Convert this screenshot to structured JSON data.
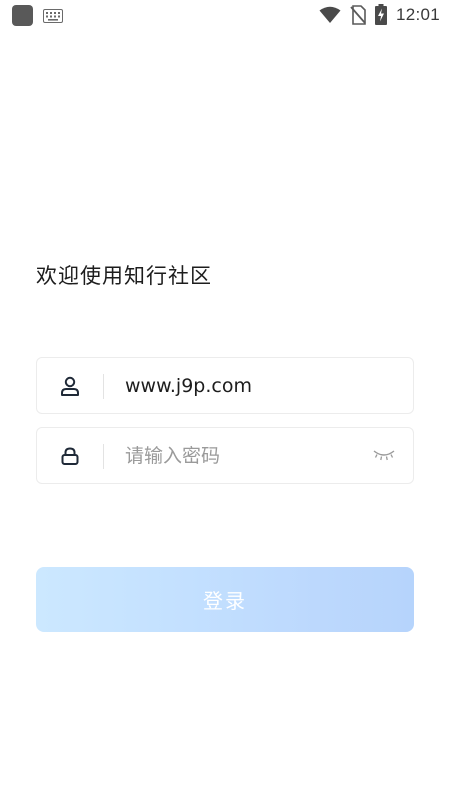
{
  "status_bar": {
    "time": "12:01",
    "icons": [
      "app-icon",
      "keyboard-icon",
      "wifi-icon",
      "no-sim-icon",
      "battery-charging-icon"
    ]
  },
  "welcome_text": "欢迎使用知行社区",
  "username_field": {
    "value": "www.j9p.com",
    "icon": "user-icon"
  },
  "password_field": {
    "value": "",
    "placeholder": "请输入密码",
    "icon": "lock-icon",
    "toggle_icon": "eye-closed-icon"
  },
  "login_button": {
    "label": "登录"
  },
  "colors": {
    "button_gradient_start": "#cce8ff",
    "button_gradient_end": "#b6d4fc",
    "text": "#1d1d1d",
    "placeholder": "#9a9a9a",
    "border": "#ececec"
  }
}
